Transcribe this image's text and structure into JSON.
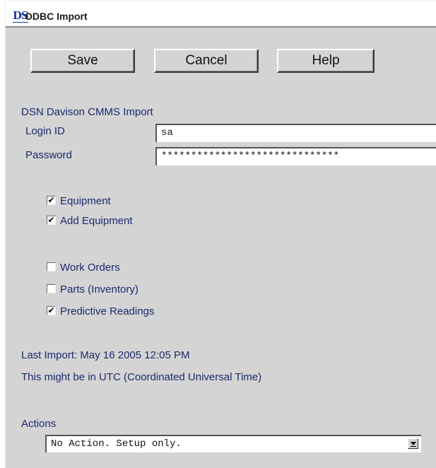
{
  "window": {
    "app_icon": "DS",
    "title": "ODBC Import"
  },
  "toolbar": {
    "save_label": "Save",
    "cancel_label": "Cancel",
    "help_label": "Help"
  },
  "connection": {
    "dsn_label": "DSN Davison CMMS Import",
    "login_label": "Login ID",
    "login_value": "sa",
    "password_label": "Password",
    "password_value": "******************************"
  },
  "options": [
    {
      "label": "Equipment",
      "checked": true,
      "mark": "✔"
    },
    {
      "label": "Add Equipment",
      "checked": true,
      "mark": "✔"
    },
    {
      "label": "Work Orders",
      "checked": false,
      "mark": ""
    },
    {
      "label": "Parts (Inventory)",
      "checked": false,
      "mark": ""
    },
    {
      "label": "Predictive Readings",
      "checked": true,
      "mark": "✔"
    }
  ],
  "status": {
    "last_import": "Last Import: May 16 2005  12:05 PM",
    "timezone_note": "This might be in UTC (Coordinated Universal Time)"
  },
  "actions": {
    "label": "Actions",
    "selected": "No Action. Setup only."
  },
  "colors": {
    "window_bg": "#d4d4d4",
    "label_text": "#1c2a6e",
    "icon_blue": "#1f3aa0"
  }
}
